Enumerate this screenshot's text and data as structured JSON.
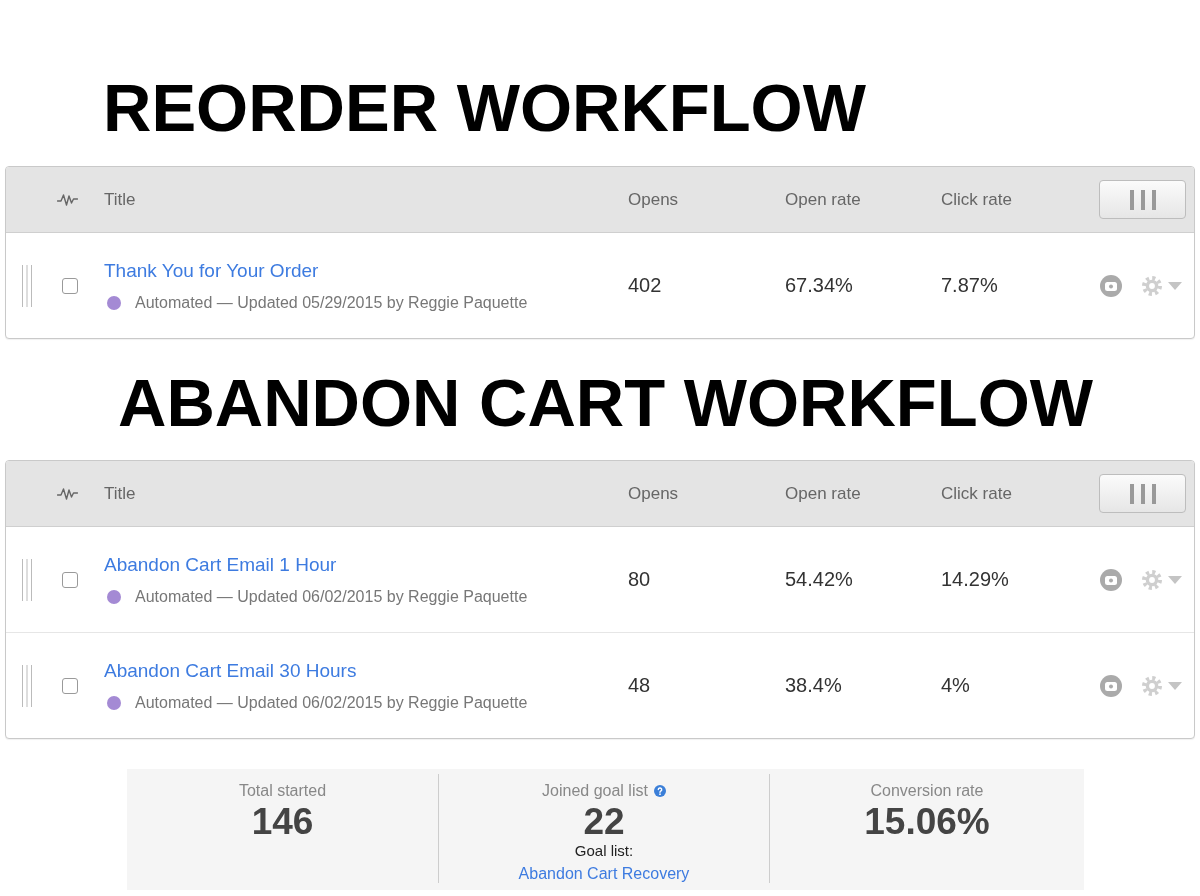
{
  "sections": [
    {
      "heading": "REORDER WORKFLOW",
      "table": {
        "columns": [
          "Title",
          "Opens",
          "Open rate",
          "Click rate"
        ],
        "rows": [
          {
            "checked": false,
            "title": "Thank You for Your Order",
            "color": "#a48ad4",
            "meta": "Automated — Updated 05/29/2015 by Reggie Paquette",
            "opens": "402",
            "open_rate": "67.34%",
            "click_rate": "7.87%"
          }
        ]
      }
    },
    {
      "heading": "ABANDON CART WORKFLOW",
      "table": {
        "columns": [
          "Title",
          "Opens",
          "Open rate",
          "Click rate"
        ],
        "rows": [
          {
            "checked": false,
            "title": "Abandon Cart Email 1 Hour",
            "color": "#a48ad4",
            "meta": "Automated — Updated 06/02/2015 by Reggie Paquette",
            "opens": "80",
            "open_rate": "54.42%",
            "click_rate": "14.29%"
          },
          {
            "checked": false,
            "title": "Abandon Cart Email 30 Hours",
            "color": "#a48ad4",
            "meta": "Automated — Updated 06/02/2015 by Reggie Paquette",
            "opens": "48",
            "open_rate": "38.4%",
            "click_rate": "4%"
          }
        ]
      }
    }
  ],
  "summary": [
    {
      "label": "Total started",
      "value": "146"
    },
    {
      "label": "Joined goal list",
      "help": true,
      "value": "22",
      "goal_label": "Goal list:",
      "goal_link": "Abandon Cart Recovery"
    },
    {
      "label": "Conversion rate",
      "value": "15.06%"
    }
  ]
}
